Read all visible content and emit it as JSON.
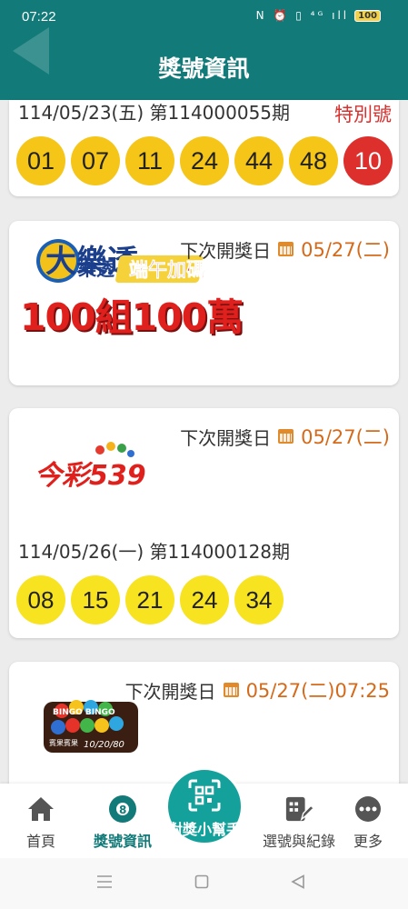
{
  "status_bar": {
    "time": "07:22",
    "icons_text": "N ⏰ ▯ ⁴ᴳ ıll",
    "battery": "100"
  },
  "header": {
    "title": "獎號資訊"
  },
  "lotto649_result": {
    "period": "114/05/23(五) 第114000055期",
    "special_label": "特別號",
    "numbers": [
      "01",
      "07",
      "11",
      "24",
      "44",
      "48"
    ],
    "special_number": "10"
  },
  "superlotto": {
    "next_draw_label": "下次開獎日",
    "next_draw_date": "05/27(二)",
    "logo_text": "大樂透",
    "logo_badge": "端午加碼",
    "promo": "100組100萬"
  },
  "daily_cash": {
    "next_draw_label": "下次開獎日",
    "next_draw_date": "05/27(二)",
    "logo_text": "今彩539",
    "period": "114/05/26(一) 第114000128期",
    "numbers": [
      "08",
      "15",
      "21",
      "24",
      "34"
    ]
  },
  "bingo": {
    "next_draw_label": "下次開獎日",
    "next_draw_date": "05/27(二)07:25",
    "logo_text": "BINGO BINGO",
    "logo_subtext": "賓果賓果",
    "logo_numbers": "10/20/80"
  },
  "bottom_nav": {
    "home": "首頁",
    "info": "獎號資訊",
    "checker": "對獎小幫手",
    "picks": "選號與紀錄",
    "more": "更多"
  },
  "colors": {
    "header": "#127a78",
    "ball": "#f5c518",
    "special_ball": "#dd2f2c",
    "accent_orange": "#d46a1a",
    "fab": "#15a19b"
  }
}
